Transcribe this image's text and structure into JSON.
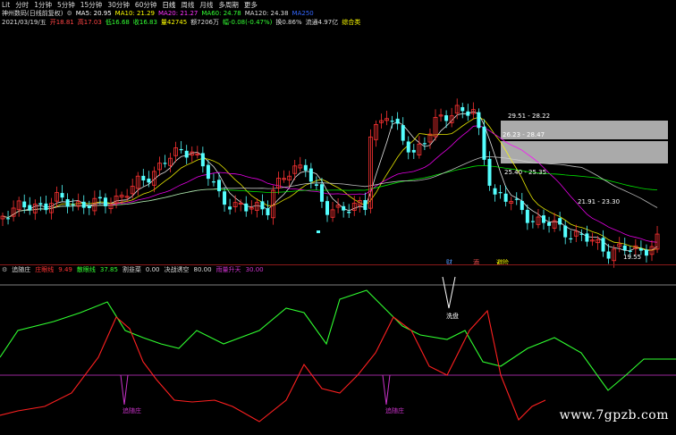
{
  "toolbar": {
    "items": [
      "Lit",
      "分时",
      "1分钟",
      "5分钟",
      "15分钟",
      "30分钟",
      "60分钟",
      "日线",
      "周线",
      "月线",
      "多周期",
      "更多"
    ],
    "selected": "日线"
  },
  "stock": {
    "name": "神州数码(日线前复权)",
    "ma5_label": "MA5: 20.95",
    "ma10_label": "MA10: 21.29",
    "ma20_label": "MA20: 21.27",
    "ma60_label": "MA60: 24.78",
    "ma120_label": "MA120: 24.38",
    "ma250_label": "MA250"
  },
  "quote": {
    "date": "2021/03/19/五",
    "open": "开18.81",
    "high": "高17.03",
    "low": "低16.68",
    "close": "收16.83",
    "volume": "量42745",
    "amount": "额7206万",
    "change": "幅-0.08(-0.47%)",
    "turnover": "换0.86%",
    "float_cap": "流通4.97亿",
    "rating": "综合类"
  },
  "price_labels": {
    "zone1": "29.51 - 28.22",
    "zone2": "26.23 - 28.47",
    "zone3": "25.40 - 25.35",
    "zone4": "21.91 - 23.30",
    "low_mark": "19.55"
  },
  "event_markers": {
    "m1": "财",
    "m2": "添",
    "m3": "避险"
  },
  "indicator": {
    "name": "追随庄",
    "zhuang_label": "庄眼线",
    "zhuang_value": "9.49",
    "sanhu_label": "散眼线",
    "sanhu_value": "37.85",
    "cut_label": "割韭菜",
    "cut_value": "0.00",
    "decide_label": "决战诱空",
    "decide_value": "80.00",
    "rise_label": "雨量升天",
    "rise_value": "30.00",
    "annot_wash": "洗盘",
    "annot_follow1": "追随庄",
    "annot_follow2": "追随庄"
  },
  "watermark": "www.7gpzb.com",
  "colors": {
    "bg": "#000000",
    "up": "#ff3333",
    "down": "#54ffff",
    "ma5": "#ffffff",
    "ma10": "#ffff00",
    "ma20": "#ff00ff",
    "ma60": "#00ff00",
    "ma120": "#d0d0d0",
    "red_line": "#ff2020",
    "green_line": "#30ff30",
    "purple": "#cc33cc",
    "zone": "#c8c8c8"
  }
}
